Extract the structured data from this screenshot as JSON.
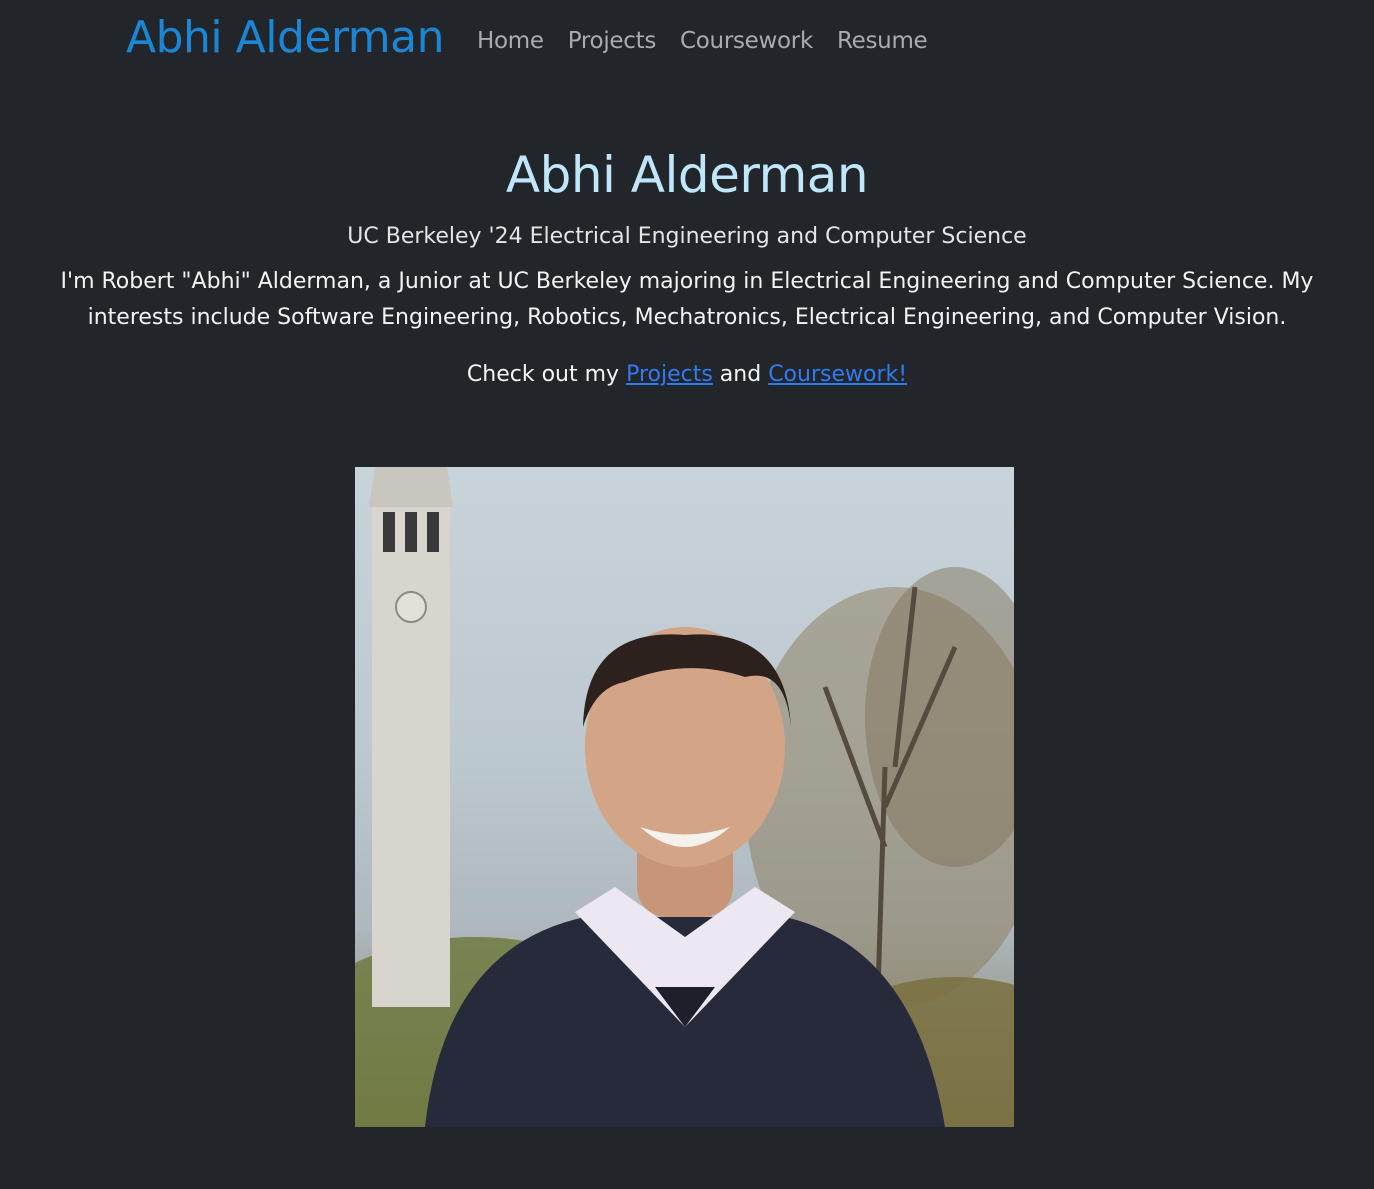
{
  "nav": {
    "brand": "Abhi Alderman",
    "links": [
      "Home",
      "Projects",
      "Coursework",
      "Resume"
    ]
  },
  "hero": {
    "title": "Abhi Alderman",
    "subtitle": "UC Berkeley '24 Electrical Engineering and Computer Science",
    "bio": "I'm Robert \"Abhi\" Alderman, a Junior at UC Berkeley majoring in Electrical Engineering and Computer Science. My interests include Software Engineering, Robotics, Mechatronics, Electrical Engineering, and Computer Vision.",
    "cta_prefix": "Check out my ",
    "cta_link1": "Projects",
    "cta_middle": " and ",
    "cta_link2": "Coursework!"
  },
  "colors": {
    "background": "#222529",
    "brand": "#1a87d6",
    "nav_link": "#a7acb1",
    "title": "#bfe6fb",
    "link": "#2f7bf1"
  }
}
